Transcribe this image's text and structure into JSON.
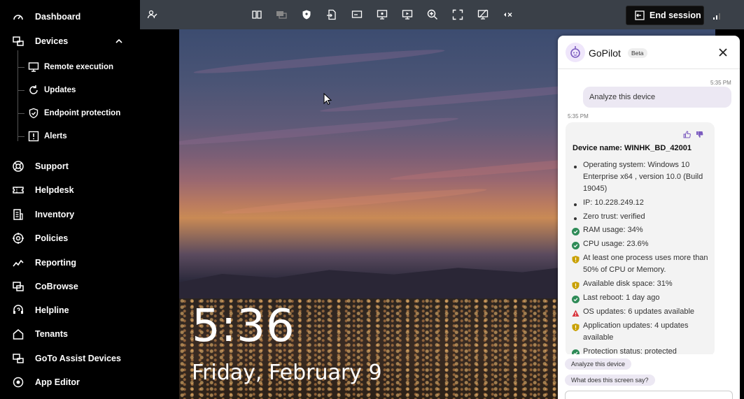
{
  "sidebar": {
    "items": [
      {
        "name": "dashboard",
        "icon": "gauge-icon",
        "label": "Dashboard"
      },
      {
        "name": "devices",
        "icon": "devices-icon",
        "label": "Devices"
      },
      {
        "name": "remote-execution",
        "icon": "monitor-icon",
        "label": "Remote execution"
      },
      {
        "name": "updates",
        "icon": "refresh-icon",
        "label": "Updates"
      },
      {
        "name": "endpoint-protection",
        "icon": "shield-icon",
        "label": "Endpoint protection"
      },
      {
        "name": "alerts",
        "icon": "alert-icon",
        "label": "Alerts"
      },
      {
        "name": "support",
        "icon": "lifebuoy-icon",
        "label": "Support"
      },
      {
        "name": "helpdesk",
        "icon": "ticket-icon",
        "label": "Helpdesk"
      },
      {
        "name": "inventory",
        "icon": "inventory-icon",
        "label": "Inventory"
      },
      {
        "name": "policies",
        "icon": "gear-icon",
        "label": "Policies"
      },
      {
        "name": "reporting",
        "icon": "chart-icon",
        "label": "Reporting"
      },
      {
        "name": "cobrowse",
        "icon": "cobrowse-icon",
        "label": "CoBrowse"
      },
      {
        "name": "helpline",
        "icon": "headset-icon",
        "label": "Helpline"
      },
      {
        "name": "tenants",
        "icon": "home-icon",
        "label": "Tenants"
      },
      {
        "name": "goto-assist-devices",
        "icon": "devices-icon",
        "label": "GoTo Assist Devices"
      },
      {
        "name": "app-editor",
        "icon": "gear-icon",
        "label": "App Editor"
      }
    ]
  },
  "toolbar": {
    "end_session_label": "End session"
  },
  "remote_screen": {
    "time": "5:36",
    "date": "Friday, February 9"
  },
  "gopilot": {
    "title": "GoPilot",
    "badge": "Beta",
    "messages": {
      "user_time": "5:35 PM",
      "user_text": "Analyze this device",
      "bot_time": "5:35 PM",
      "device_name": "Device name: WINHK_BD_42001",
      "bullets": [
        "Operating system: Windows 10 Enterprise x64 , version 10.0 (Build 19045)",
        "IP: 10.228.249.12",
        "Zero trust: verified"
      ],
      "statuses": [
        {
          "status": "ok",
          "text": "RAM usage: 34%"
        },
        {
          "status": "ok",
          "text": "CPU usage: 23.6%"
        },
        {
          "status": "warn",
          "text": "At least one process uses more than 50% of CPU or Memory."
        },
        {
          "status": "warn",
          "text": "Available disk space: 31%"
        },
        {
          "status": "ok",
          "text": "Last reboot: 1 day ago"
        },
        {
          "status": "error",
          "text": "OS updates: 6 updates available"
        },
        {
          "status": "warn",
          "text": "Application updates: 4 updates available"
        },
        {
          "status": "ok",
          "text": "Protection status: protected"
        }
      ]
    },
    "suggestions": [
      "Analyze this device",
      "What does this screen say?"
    ]
  },
  "colors": {
    "ok": "#2e8b57",
    "warn": "#c9a000",
    "error": "#d9363e",
    "accent": "#7b5bbf"
  }
}
